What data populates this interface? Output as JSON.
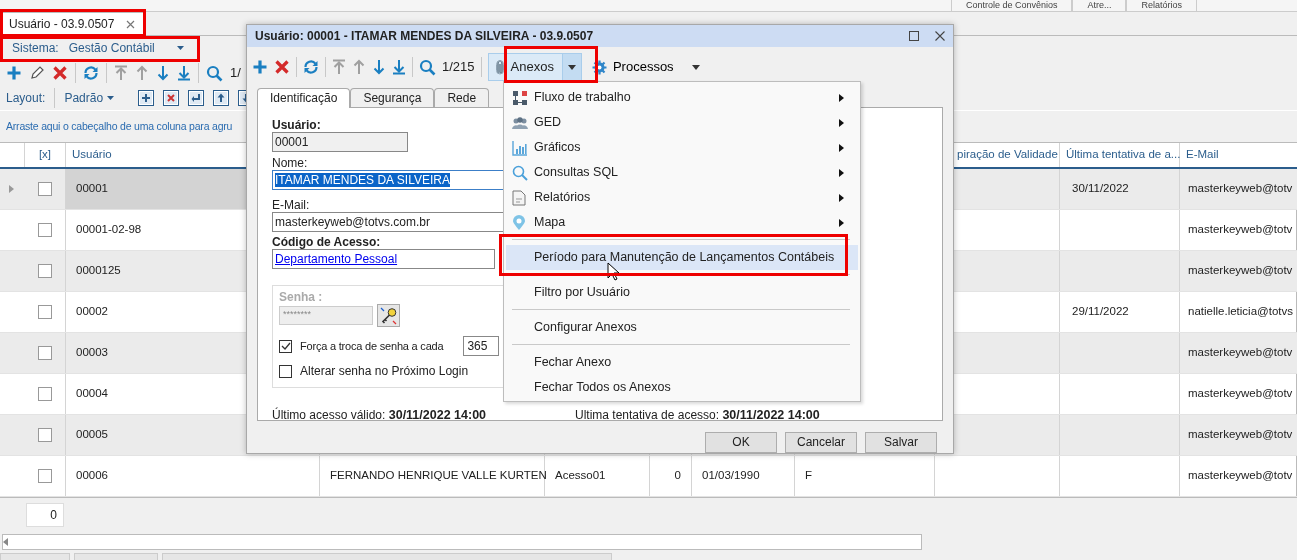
{
  "ribbon_tabs": [
    "Controle de Convênios",
    "Atre...",
    "Relatórios"
  ],
  "document_tab": {
    "label": "Usuário - 03.9.0507",
    "selected": true
  },
  "system_selector": {
    "label": "Sistema:",
    "value": "Gestão Contábil"
  },
  "toolbar": {
    "record_counter": "1/"
  },
  "layout_bar": {
    "label": "Layout:",
    "value": "Padrão"
  },
  "group_panel": {
    "hint": "Arraste aqui o cabeçalho de uma coluna para agru"
  },
  "grid": {
    "columns": {
      "checkbox": "[x]",
      "user": "Usuário",
      "expiration": "piração de Validade",
      "last_attempt": "Última tentativa de a...",
      "email": "E-Mail"
    },
    "rows": [
      {
        "selected": true,
        "checked": false,
        "user": "00001",
        "last_attempt": "30/11/2022",
        "email": "masterkeyweb@totv"
      },
      {
        "selected": false,
        "checked": false,
        "user": "00001-02-98",
        "email": "masterkeyweb@totv"
      },
      {
        "selected": false,
        "checked": false,
        "user": "0000125",
        "email": "masterkeyweb@totv"
      },
      {
        "selected": false,
        "checked": false,
        "user": "00002",
        "last_attempt": "29/11/2022",
        "email": "natielle.leticia@totvs"
      },
      {
        "selected": false,
        "checked": false,
        "user": "00003",
        "email": "masterkeyweb@totv"
      },
      {
        "selected": false,
        "checked": false,
        "user": "00004",
        "email": "masterkeyweb@totv"
      },
      {
        "selected": false,
        "checked": false,
        "user": "00005",
        "email": "masterkeyweb@totv"
      },
      {
        "selected": false,
        "checked": false,
        "user": "00006",
        "column_3": "FERNANDO HENRIQUE VALLE KURTEN",
        "column_4": "Acesso01",
        "column_5": "0",
        "column_6": "01/03/1990",
        "column_7": "F",
        "email": "masterkeyweb@totv"
      }
    ]
  },
  "footer": {
    "count": "0"
  },
  "dialog": {
    "title": "Usuário: 00001 - ITAMAR MENDES DA SILVEIRA - 03.9.0507",
    "record_counter": "1/215",
    "attachments_button": {
      "label": "Anexos",
      "expanded": true
    },
    "processes_button": {
      "label": "Processos"
    },
    "tabs": [
      {
        "label": "Identificação",
        "selected": true
      },
      {
        "label": "Segurança",
        "selected": false
      },
      {
        "label": "Rede",
        "selected": false
      }
    ],
    "form": {
      "user_label": "Usuário:",
      "user_value": "00001",
      "name_label": "Nome:",
      "name_value": "ITAMAR MENDES DA SILVEIRA",
      "name_text_selected": true,
      "email_label": "E-Mail:",
      "email_value": "masterkeyweb@totvs.com.br",
      "access_label": "Código de Acesso:",
      "access_value": "Departamento Pessoal",
      "password_label": "Senha :",
      "password_value": "********",
      "password_disabled": true,
      "force_change": {
        "label": "Força a troca de senha a cada",
        "checked": true,
        "days": "365"
      },
      "change_next_login": {
        "label": "Alterar senha no Próximo Login",
        "checked": false
      }
    },
    "last_valid": {
      "label": "Último acesso válido:",
      "value": "30/11/2022 14:00"
    },
    "last_attempt": {
      "label": "Ultima tentativa de acesso:",
      "value": "30/11/2022 14:00"
    },
    "buttons": [
      "OK",
      "Cancelar",
      "Salvar"
    ]
  },
  "menu": {
    "items": [
      {
        "kind": "submenu",
        "label": "Fluxo de trabalho",
        "highlighted": false
      },
      {
        "kind": "submenu",
        "label": "GED",
        "highlighted": false
      },
      {
        "kind": "submenu",
        "label": "Gráficos",
        "highlighted": false
      },
      {
        "kind": "submenu",
        "label": "Consultas SQL",
        "highlighted": false
      },
      {
        "kind": "submenu",
        "label": "Relatórios",
        "highlighted": false
      },
      {
        "kind": "submenu",
        "label": "Mapa",
        "highlighted": false
      },
      {
        "kind": "separator"
      },
      {
        "kind": "action",
        "label": "Período para Manutenção de Lançamentos Contábeis",
        "highlighted": true
      },
      {
        "kind": "separator"
      },
      {
        "kind": "action",
        "label": "Filtro por Usuário",
        "highlighted": false
      },
      {
        "kind": "separator"
      },
      {
        "kind": "action",
        "label": "Configurar Anexos",
        "highlighted": false
      },
      {
        "kind": "separator"
      },
      {
        "kind": "action",
        "label": "Fechar Anexo",
        "highlighted": false
      },
      {
        "kind": "action",
        "label": "Fechar Todos os Anexos",
        "highlighted": false
      }
    ]
  }
}
